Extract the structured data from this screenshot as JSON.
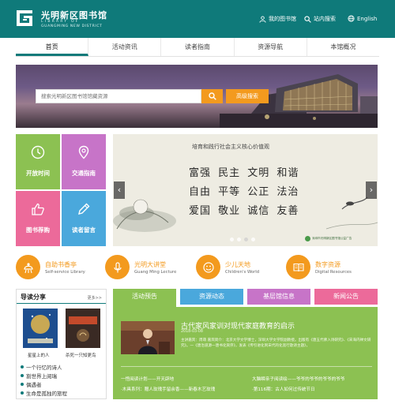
{
  "header": {
    "logo_cn": "光明新区图书馆",
    "logo_en_line1": "LIBRARY OF",
    "logo_en_line2": "GUANGMING NEW DISTRICT",
    "my_library": "我的图书馆",
    "site_search": "站内搜索",
    "english": "English",
    "bg_color": "#0f7a7a"
  },
  "nav": {
    "items": [
      "首页",
      "活动资讯",
      "读者指南",
      "资源导航",
      "本馆概况"
    ]
  },
  "search": {
    "placeholder": "搜索光明新区图书馆馆藏资源",
    "advanced_label": "高级搜索",
    "accent": "#f39a1e"
  },
  "tiles": [
    {
      "label": "开放时间",
      "icon": "clock-icon",
      "color": "#8cc152"
    },
    {
      "label": "交通指南",
      "icon": "location-pin-icon",
      "color": "#c774c8"
    },
    {
      "label": "图书荐购",
      "icon": "thumbs-up-icon",
      "color": "#ec6a9a"
    },
    {
      "label": "读者留言",
      "icon": "pencil-icon",
      "color": "#4aa8dc"
    }
  ],
  "slide": {
    "title": "培育和践行社会主义核心价值观",
    "row1": "富强 民主 文明 和谐",
    "row2": "自由 平等 公正 法治",
    "row3": "爱国 敬业 诚信 友善",
    "badge": "深圳市光明新区图书馆公益广告",
    "prev": "‹",
    "next": "›"
  },
  "services": [
    {
      "name": "自助书香亭",
      "en": "Self-service Library",
      "color": "#f39a1e",
      "icon": "book-kiosk-icon"
    },
    {
      "name": "光明大讲堂",
      "en": "Guang Ming Lecture",
      "color": "#f39a1e",
      "icon": "microphone-icon"
    },
    {
      "name": "少儿天地",
      "en": "Children's World",
      "color": "#f39a1e",
      "icon": "smiley-face-icon"
    },
    {
      "name": "数字资源",
      "en": "Digital Resources",
      "color": "#f39a1e",
      "icon": "open-book-icon"
    }
  ],
  "reading": {
    "title": "导读分享",
    "more": "更多>>",
    "books": [
      {
        "caption": "星星上的人"
      },
      {
        "caption": "杀死一只知更鸟"
      }
    ],
    "items": [
      "一个行忆的诗人",
      "割世界上阅瑞",
      "偶遇者",
      "生命是孤独的旅程"
    ]
  },
  "news": {
    "tabs": [
      {
        "label": "活动预告",
        "color": "#8cc152"
      },
      {
        "label": "资源动态",
        "color": "#4aa8dc"
      },
      {
        "label": "基层馆信息",
        "color": "#c774c8"
      },
      {
        "label": "新闻公告",
        "color": "#ec6a9a"
      }
    ],
    "headline": "古代家风家训对现代家庭教育的启示",
    "date": "2018-03-08",
    "desc": "主讲嘉宾：周萌 嘉宾简介：北京大学文学博士，深圳大学文学院副教授。出版有《唐五代佛入诗研究》、《宋海内禅文研究》。一《唐治道源一唐书化资序》，发表《传引进化到宋代的化宽行歌诗主题》，",
    "items": [
      "一悟阅读计划——开天辟地",
      "大脑瞬亲子阅读绘——爷爷的爷爷的爷爷的爷爷",
      "·木具系列：赠人玫瑰手留余香——新春木艺玫瑰",
      "·第116期：古人如何过传统节日"
    ]
  }
}
